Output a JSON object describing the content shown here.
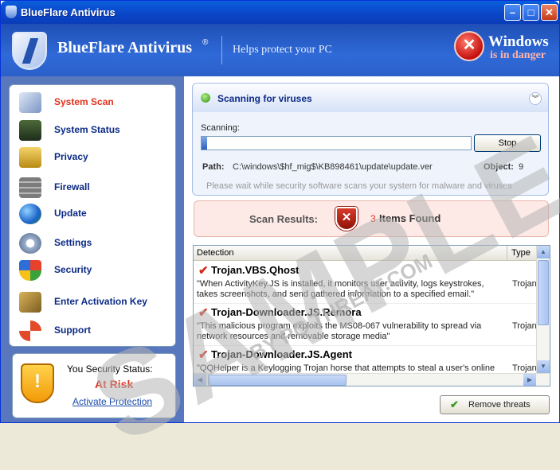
{
  "window": {
    "title": "BlueFlare Antivirus"
  },
  "header": {
    "app_name": "BlueFlare Antivirus",
    "registered": "®",
    "tagline": "Helps protect your PC",
    "danger_title": "Windows",
    "danger_subtitle": "is in danger"
  },
  "sidebar": {
    "items": [
      {
        "label": "System Scan",
        "icon": "magnifier-icon",
        "active": true
      },
      {
        "label": "System Status",
        "icon": "monitor-icon"
      },
      {
        "label": "Privacy",
        "icon": "padlock-icon"
      },
      {
        "label": "Firewall",
        "icon": "firewall-icon"
      },
      {
        "label": "Update",
        "icon": "globe-icon"
      },
      {
        "label": "Settings",
        "icon": "gears-icon"
      },
      {
        "label": "Security",
        "icon": "windows-shield-icon"
      },
      {
        "label": "Enter Activation Key",
        "icon": "key-icon"
      },
      {
        "label": "Support",
        "icon": "lifebuoy-icon"
      }
    ]
  },
  "security_status": {
    "label": "You Security Status:",
    "value": "At Risk",
    "link": "Activate Protection"
  },
  "scan": {
    "title": "Scanning for viruses",
    "scanning_label": "Scanning:",
    "progress_fraction": 0.02,
    "stop_label": "Stop",
    "path_label": "Path:",
    "path_value": "C:\\windows\\$hf_mig$\\KB898461\\update\\update.ver",
    "object_label": "Object:",
    "object_value": "9",
    "wait_message": "Please wait while security software scans your system for malware and viruses"
  },
  "results": {
    "label": "Scan Results:",
    "count": "3",
    "found_text": "Items Found"
  },
  "grid": {
    "columns": [
      "Detection",
      "Type"
    ],
    "rows": [
      {
        "name": "Trojan.VBS.Qhost",
        "description": "\"When ActivityKey.JS is installed, it monitors user activity, logs keystrokes, takes screenshots, and send gathered information to a specified email.\"",
        "type": "Trojan"
      },
      {
        "name": "Trojan-Downloader.JS.Remora",
        "description": "\"This malicious program exploits the MS08-067 vulnerability to spread via network resources and removable storage media\"",
        "type": "Trojan"
      },
      {
        "name": "Trojan-Downloader.JS.Agent",
        "description": "\"QQHelper is a Keylogging Trojan horse that attempts to steal a user's online",
        "type": "Trojan"
      }
    ]
  },
  "actions": {
    "remove_label": "Remove threats"
  },
  "watermark": {
    "main": "SAMPLE",
    "sub": "BY PC THREAT.COM"
  },
  "colors": {
    "accent_blue": "#0B2A86",
    "danger_red": "#E0321C",
    "body_blue": "#5977bd"
  }
}
